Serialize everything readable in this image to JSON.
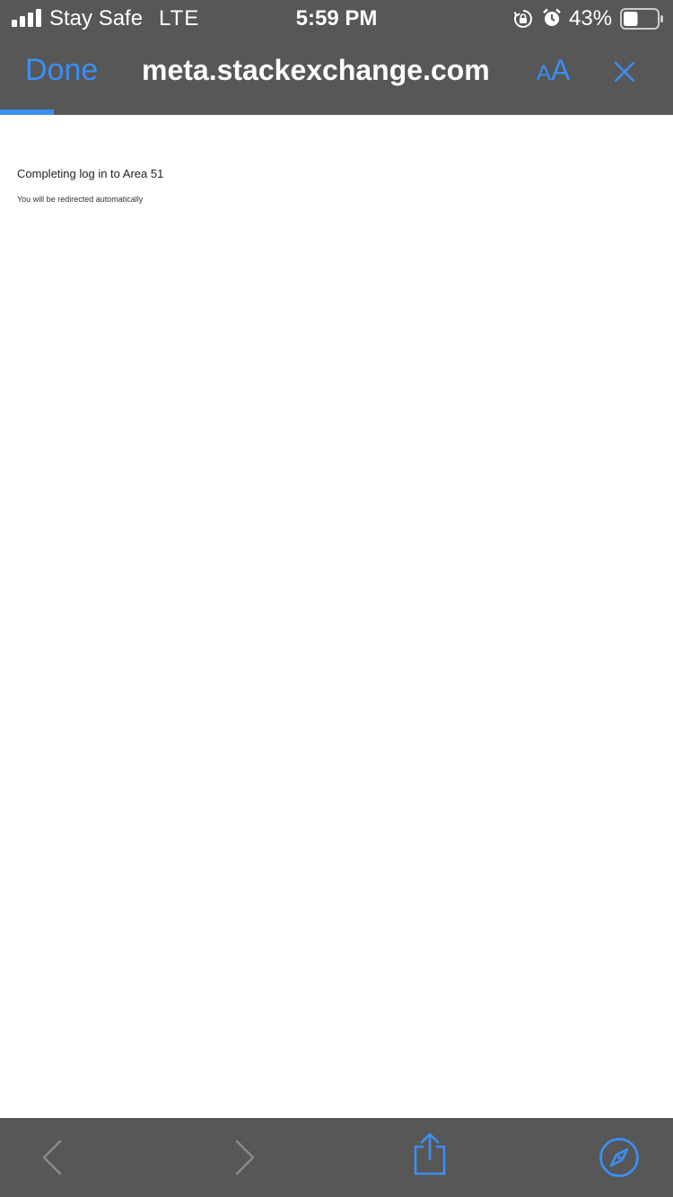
{
  "status_bar": {
    "carrier": "Stay Safe",
    "network": "LTE",
    "time": "5:59 PM",
    "battery_percent": "43%",
    "battery_level": 0.43,
    "icons": [
      "signal-icon",
      "rotation-lock-icon",
      "alarm-icon",
      "battery-icon"
    ]
  },
  "nav_bar": {
    "done_label": "Done",
    "url": "meta.stackexchange.com",
    "text_size_small": "A",
    "text_size_large": "A",
    "load_progress": 0.08
  },
  "page": {
    "heading": "Completing log in to Area 51",
    "subtext": "You will be redirected automatically"
  },
  "toolbar": {
    "icons": [
      "back-chevron-icon",
      "forward-chevron-icon",
      "share-icon",
      "safari-compass-icon"
    ]
  },
  "colors": {
    "chrome_bg": "#575757",
    "accent": "#3b8ff5",
    "disabled": "#8a8a8a",
    "page_bg": "#ffffff"
  }
}
